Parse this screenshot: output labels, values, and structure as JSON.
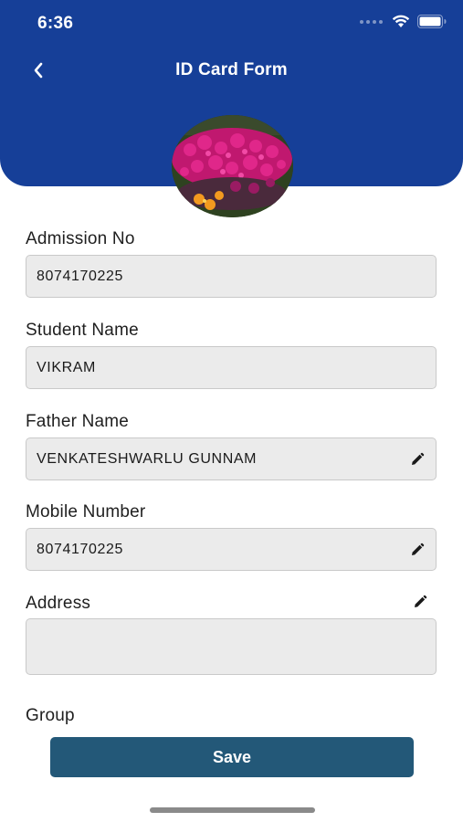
{
  "status_bar": {
    "time": "6:36"
  },
  "header": {
    "title": "ID Card Form"
  },
  "avatar": {
    "description_icon": "flower-photo"
  },
  "form": {
    "admission_no": {
      "label": "Admission No",
      "value": "8074170225"
    },
    "student_name": {
      "label": "Student Name",
      "value": "VIKRAM"
    },
    "father_name": {
      "label": "Father Name",
      "value": "VENKATESHWARLU GUNNAM"
    },
    "mobile_number": {
      "label": "Mobile Number",
      "value": "8074170225"
    },
    "address": {
      "label": "Address",
      "value": ""
    },
    "group": {
      "label": "Group"
    }
  },
  "actions": {
    "save_label": "Save"
  },
  "colors": {
    "header_bg": "#163f98",
    "save_bg": "#235878",
    "field_bg": "#ebebeb"
  },
  "icons": [
    "back-chevron-icon",
    "wifi-icon",
    "battery-icon",
    "signal-icon",
    "pencil-icon"
  ]
}
